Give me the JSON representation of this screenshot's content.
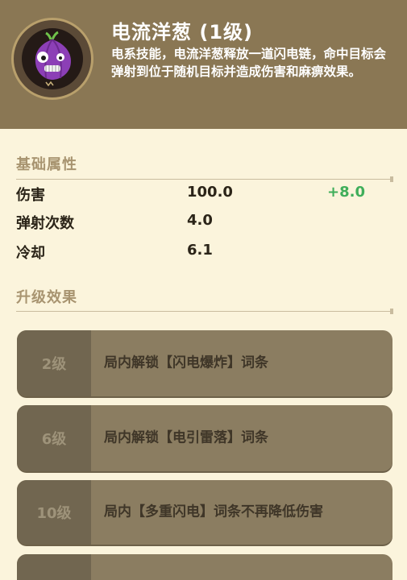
{
  "skill": {
    "title": "电流洋葱 (1级)",
    "description": "电系技能，电流洋葱释放一道闪电链，命中目标会弹射到位于随机目标并造成伤害和麻痹效果。",
    "icon": "electric-onion-icon"
  },
  "base_attributes": {
    "section_title": "基础属性",
    "rows": [
      {
        "label": "伤害",
        "value": "100.0",
        "bonus": "+8.0"
      },
      {
        "label": "弹射次数",
        "value": "4.0",
        "bonus": ""
      },
      {
        "label": "冷却",
        "value": "6.1",
        "bonus": ""
      }
    ]
  },
  "upgrades": {
    "section_title": "升级效果",
    "items": [
      {
        "level": "2级",
        "text": "局内解锁【闪电爆炸】词条"
      },
      {
        "level": "6级",
        "text": "局内解锁【电引雷落】词条"
      },
      {
        "level": "10级",
        "text": "局内【多重闪电】词条不再降低伤害"
      }
    ]
  },
  "colors": {
    "header_bg": "#8a7754",
    "page_bg": "#fbf4dc",
    "bonus_green": "#3fae5a",
    "card_bg": "#8b7d61"
  }
}
